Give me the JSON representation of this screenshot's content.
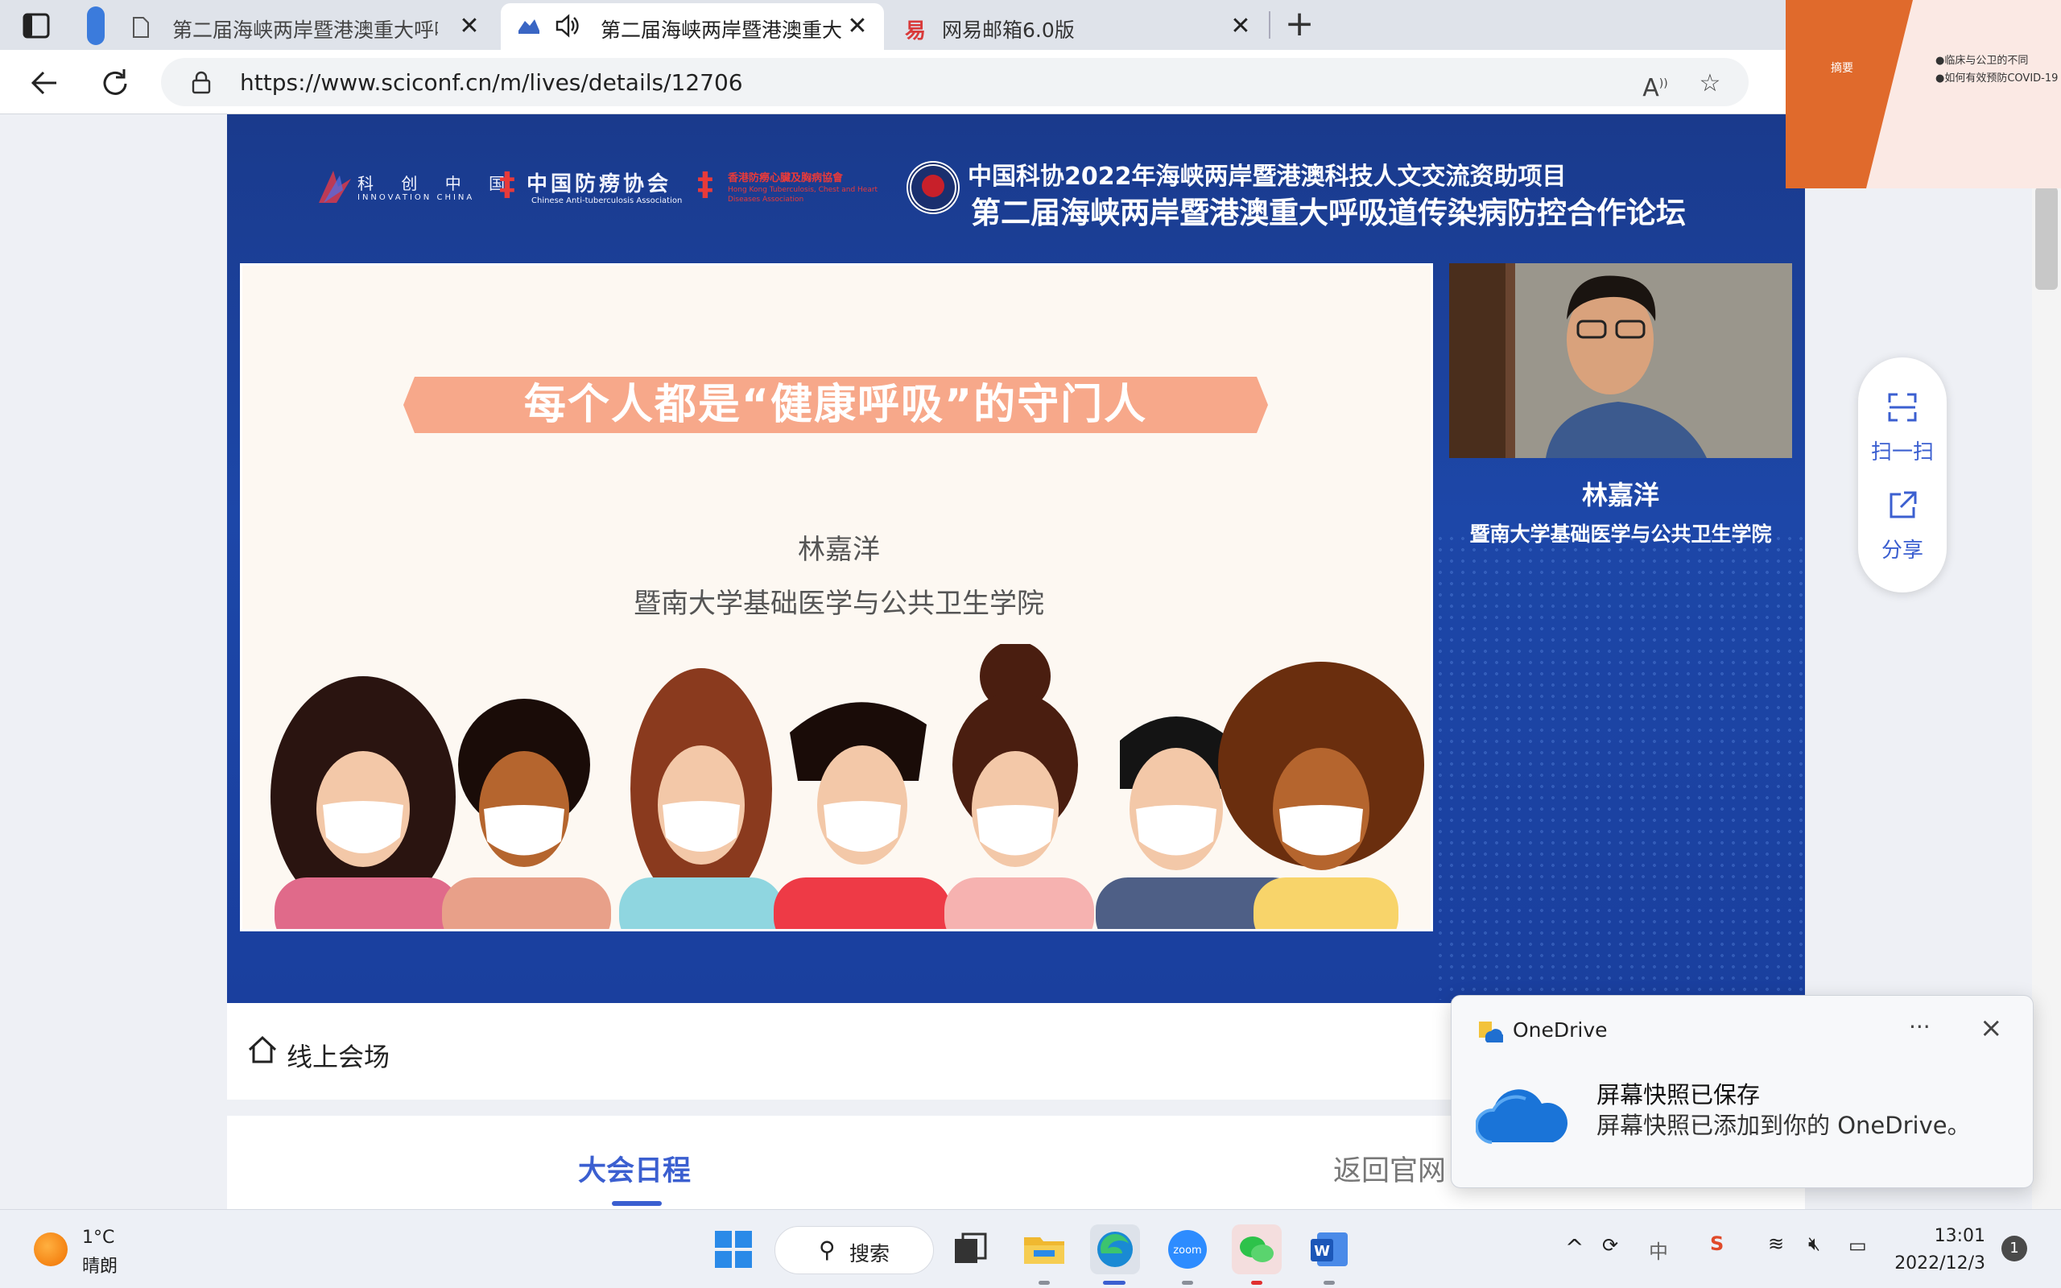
{
  "browser": {
    "tabs": [
      {
        "title": "第二届海峡两岸暨港澳重大呼吸道",
        "active": false
      },
      {
        "title": "第二届海峡两岸暨港澳重大呼吸",
        "active": true
      },
      {
        "title": "网易邮箱6.0版",
        "active": false
      }
    ],
    "close_glyph": "✕",
    "new_tab_glyph": "+",
    "url": "https://www.sciconf.cn/m/lives/details/12706"
  },
  "banner": {
    "logo_innovation": "科 创 中 国",
    "logo_innovation_en": "INNOVATION CHINA",
    "logo_anti_tb": "中国防痨协会",
    "logo_anti_tb_en": "Chinese Anti-tuberculosis Association",
    "logo_hk": "香港防癆心臟及胸病協會",
    "logo_hk_en": "Hong Kong Tuberculosis, Chest and Heart Diseases Association",
    "line1": "中国科协2022年海峡两岸暨港澳科技人文交流资助项目",
    "line2": "第二届海峡两岸暨港澳重大呼吸道传染病防控合作论坛"
  },
  "slide": {
    "title": "每个人都是“健康呼吸”的守门人",
    "speaker": "林嘉洋",
    "institution": "暨南大学基础医学与公共卫生学院"
  },
  "speaker_panel": {
    "name": "林嘉洋",
    "institution": "暨南大学基础医学与公共卫生学院"
  },
  "float_panel": {
    "scan_label": "扫一扫",
    "share_label": "分享"
  },
  "venue": {
    "label": "线上会场"
  },
  "page_tabs": {
    "agenda": "大会日程",
    "back": "返回官网"
  },
  "preview": {
    "title": "摘要",
    "lines": [
      "●临床与公卫的不同",
      "●如何有效预防COVID-19"
    ]
  },
  "toast": {
    "app": "OneDrive",
    "more": "···",
    "title": "屏幕快照已保存",
    "body": "屏幕快照已添加到你的 OneDrive。"
  },
  "taskbar": {
    "temperature": "1°C",
    "weather": "晴朗",
    "search": "搜索",
    "tray_ime": "中",
    "time": "13:01",
    "date": "2022/12/3",
    "notifications": "1"
  },
  "colors": {
    "banner_blue": "#1d47a8",
    "accent_blue": "#3b5fd0",
    "ribbon_salmon": "#f7a88a"
  }
}
